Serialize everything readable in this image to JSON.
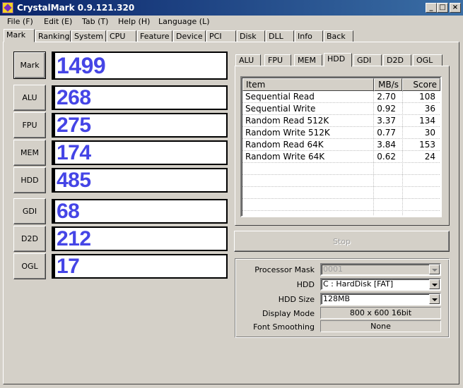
{
  "window": {
    "title": "CrystalMark 0.9.121.320",
    "controls": [
      "_",
      "□",
      "×"
    ]
  },
  "menu": [
    "File (F)",
    "Edit (E)",
    "Tab (T)",
    "Help (H)",
    "Language (L)"
  ],
  "tabs": [
    "Mark",
    "Ranking",
    "System",
    "CPU",
    "Feature",
    "Device",
    "PCI",
    "Disk",
    "DLL",
    "Info",
    "Back"
  ],
  "scores": {
    "mark": {
      "label": "Mark",
      "value": "1499"
    },
    "alu": {
      "label": "ALU",
      "value": "268"
    },
    "fpu": {
      "label": "FPU",
      "value": "275"
    },
    "mem": {
      "label": "MEM",
      "value": "174"
    },
    "hdd": {
      "label": "HDD",
      "value": "485"
    },
    "gdi": {
      "label": "GDI",
      "value": "68"
    },
    "d2d": {
      "label": "D2D",
      "value": "212"
    },
    "ogl": {
      "label": "OGL",
      "value": "17"
    }
  },
  "inner_tabs": [
    "ALU",
    "FPU",
    "MEM",
    "HDD",
    "GDI",
    "D2D",
    "OGL"
  ],
  "hdd_table": {
    "columns": [
      "Item",
      "MB/s",
      "Score"
    ],
    "rows": [
      [
        "Sequential Read",
        "2.70",
        "108"
      ],
      [
        "Sequential Write",
        "0.92",
        "36"
      ],
      [
        "Random Read 512K",
        "3.37",
        "134"
      ],
      [
        "Random Write 512K",
        "0.77",
        "30"
      ],
      [
        "Random Read 64K",
        "3.84",
        "153"
      ],
      [
        "Random Write 64K",
        "0.62",
        "24"
      ]
    ]
  },
  "stop_label": "Stop",
  "settings": {
    "processor_mask": {
      "label": "Processor Mask",
      "value": "0001"
    },
    "hdd": {
      "label": "HDD",
      "value": "C : HardDisk [FAT]"
    },
    "hdd_size": {
      "label": "HDD Size",
      "value": "128MB"
    },
    "display_mode": {
      "label": "Display Mode",
      "value": "800 x 600 16bit"
    },
    "font_smoothing": {
      "label": "Font Smoothing",
      "value": "None"
    }
  },
  "colors": {
    "score_text": "#4545e6",
    "titlebar_start": "#0a246a",
    "titlebar_end": "#3a6ea5",
    "face": "#d4d0c8"
  }
}
